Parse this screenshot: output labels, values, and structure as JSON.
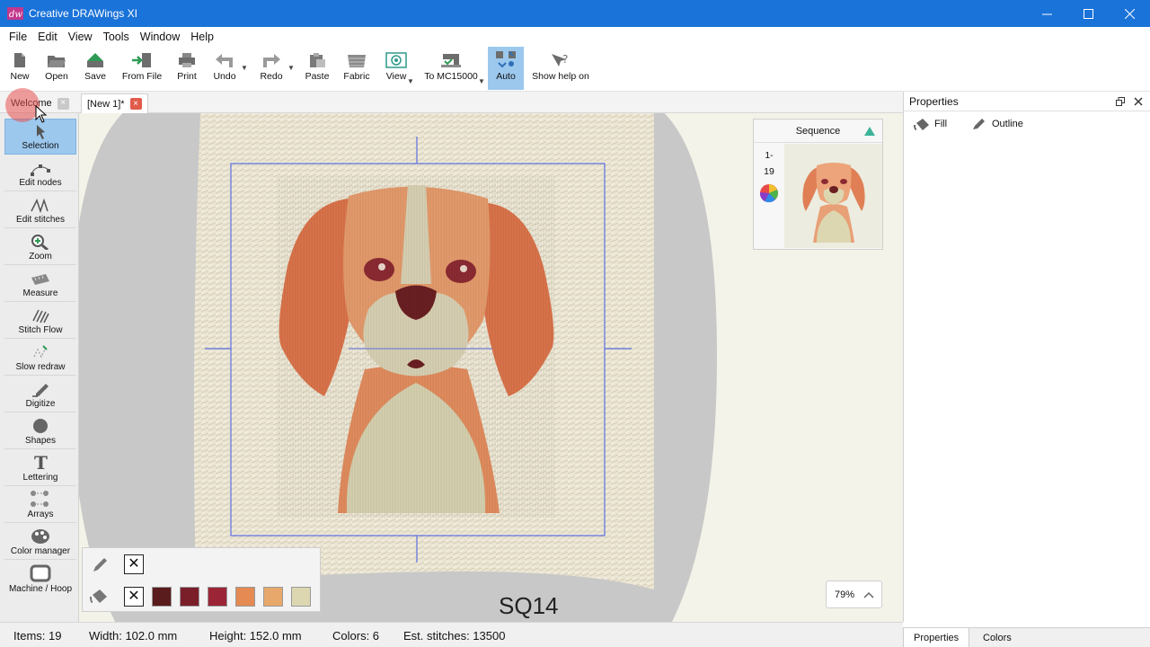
{
  "window": {
    "title": "Creative DRAWings XI"
  },
  "menu": [
    "File",
    "Edit",
    "View",
    "Tools",
    "Window",
    "Help"
  ],
  "toolbar": {
    "new": "New",
    "open": "Open",
    "save": "Save",
    "from_file": "From File",
    "print": "Print",
    "undo": "Undo",
    "redo": "Redo",
    "paste": "Paste",
    "fabric": "Fabric",
    "view": "View",
    "to_machine": "To MC15000",
    "auto": "Auto",
    "show_help": "Show help on"
  },
  "tabs": {
    "welcome": "Welcome",
    "document": "[New 1]*"
  },
  "tools": {
    "selection": "Selection",
    "edit_nodes": "Edit nodes",
    "edit_stitches": "Edit stitches",
    "zoom": "Zoom",
    "measure": "Measure",
    "stitch_flow": "Stitch Flow",
    "slow_redraw": "Slow redraw",
    "digitize": "Digitize",
    "shapes": "Shapes",
    "lettering": "Lettering",
    "arrays": "Arrays",
    "color_manager": "Color manager",
    "machine_hoop": "Machine / Hoop"
  },
  "sequence": {
    "title": "Sequence",
    "range_start": "1-",
    "range_end": "19"
  },
  "palette": {
    "swatches": [
      "#5a1c1c",
      "#7a1f2a",
      "#9b2436",
      "#e48a52",
      "#e8a86c",
      "#dcd7b0"
    ]
  },
  "canvas": {
    "hoop_label": "SQ14",
    "zoom": "79%"
  },
  "properties": {
    "title": "Properties",
    "fill_tab": "Fill",
    "outline_tab": "Outline"
  },
  "status": {
    "items": "Items: 19",
    "width": "Width: 102.0 mm",
    "height": "Height: 152.0 mm",
    "colors": "Colors: 6",
    "stitches": "Est. stitches: 13500"
  },
  "bottom_tabs": {
    "properties": "Properties",
    "colors": "Colors"
  },
  "colors": {
    "titlebar": "#1a73d9",
    "active_tool": "#9cc8ee",
    "tab_close": "#e15a4a"
  }
}
